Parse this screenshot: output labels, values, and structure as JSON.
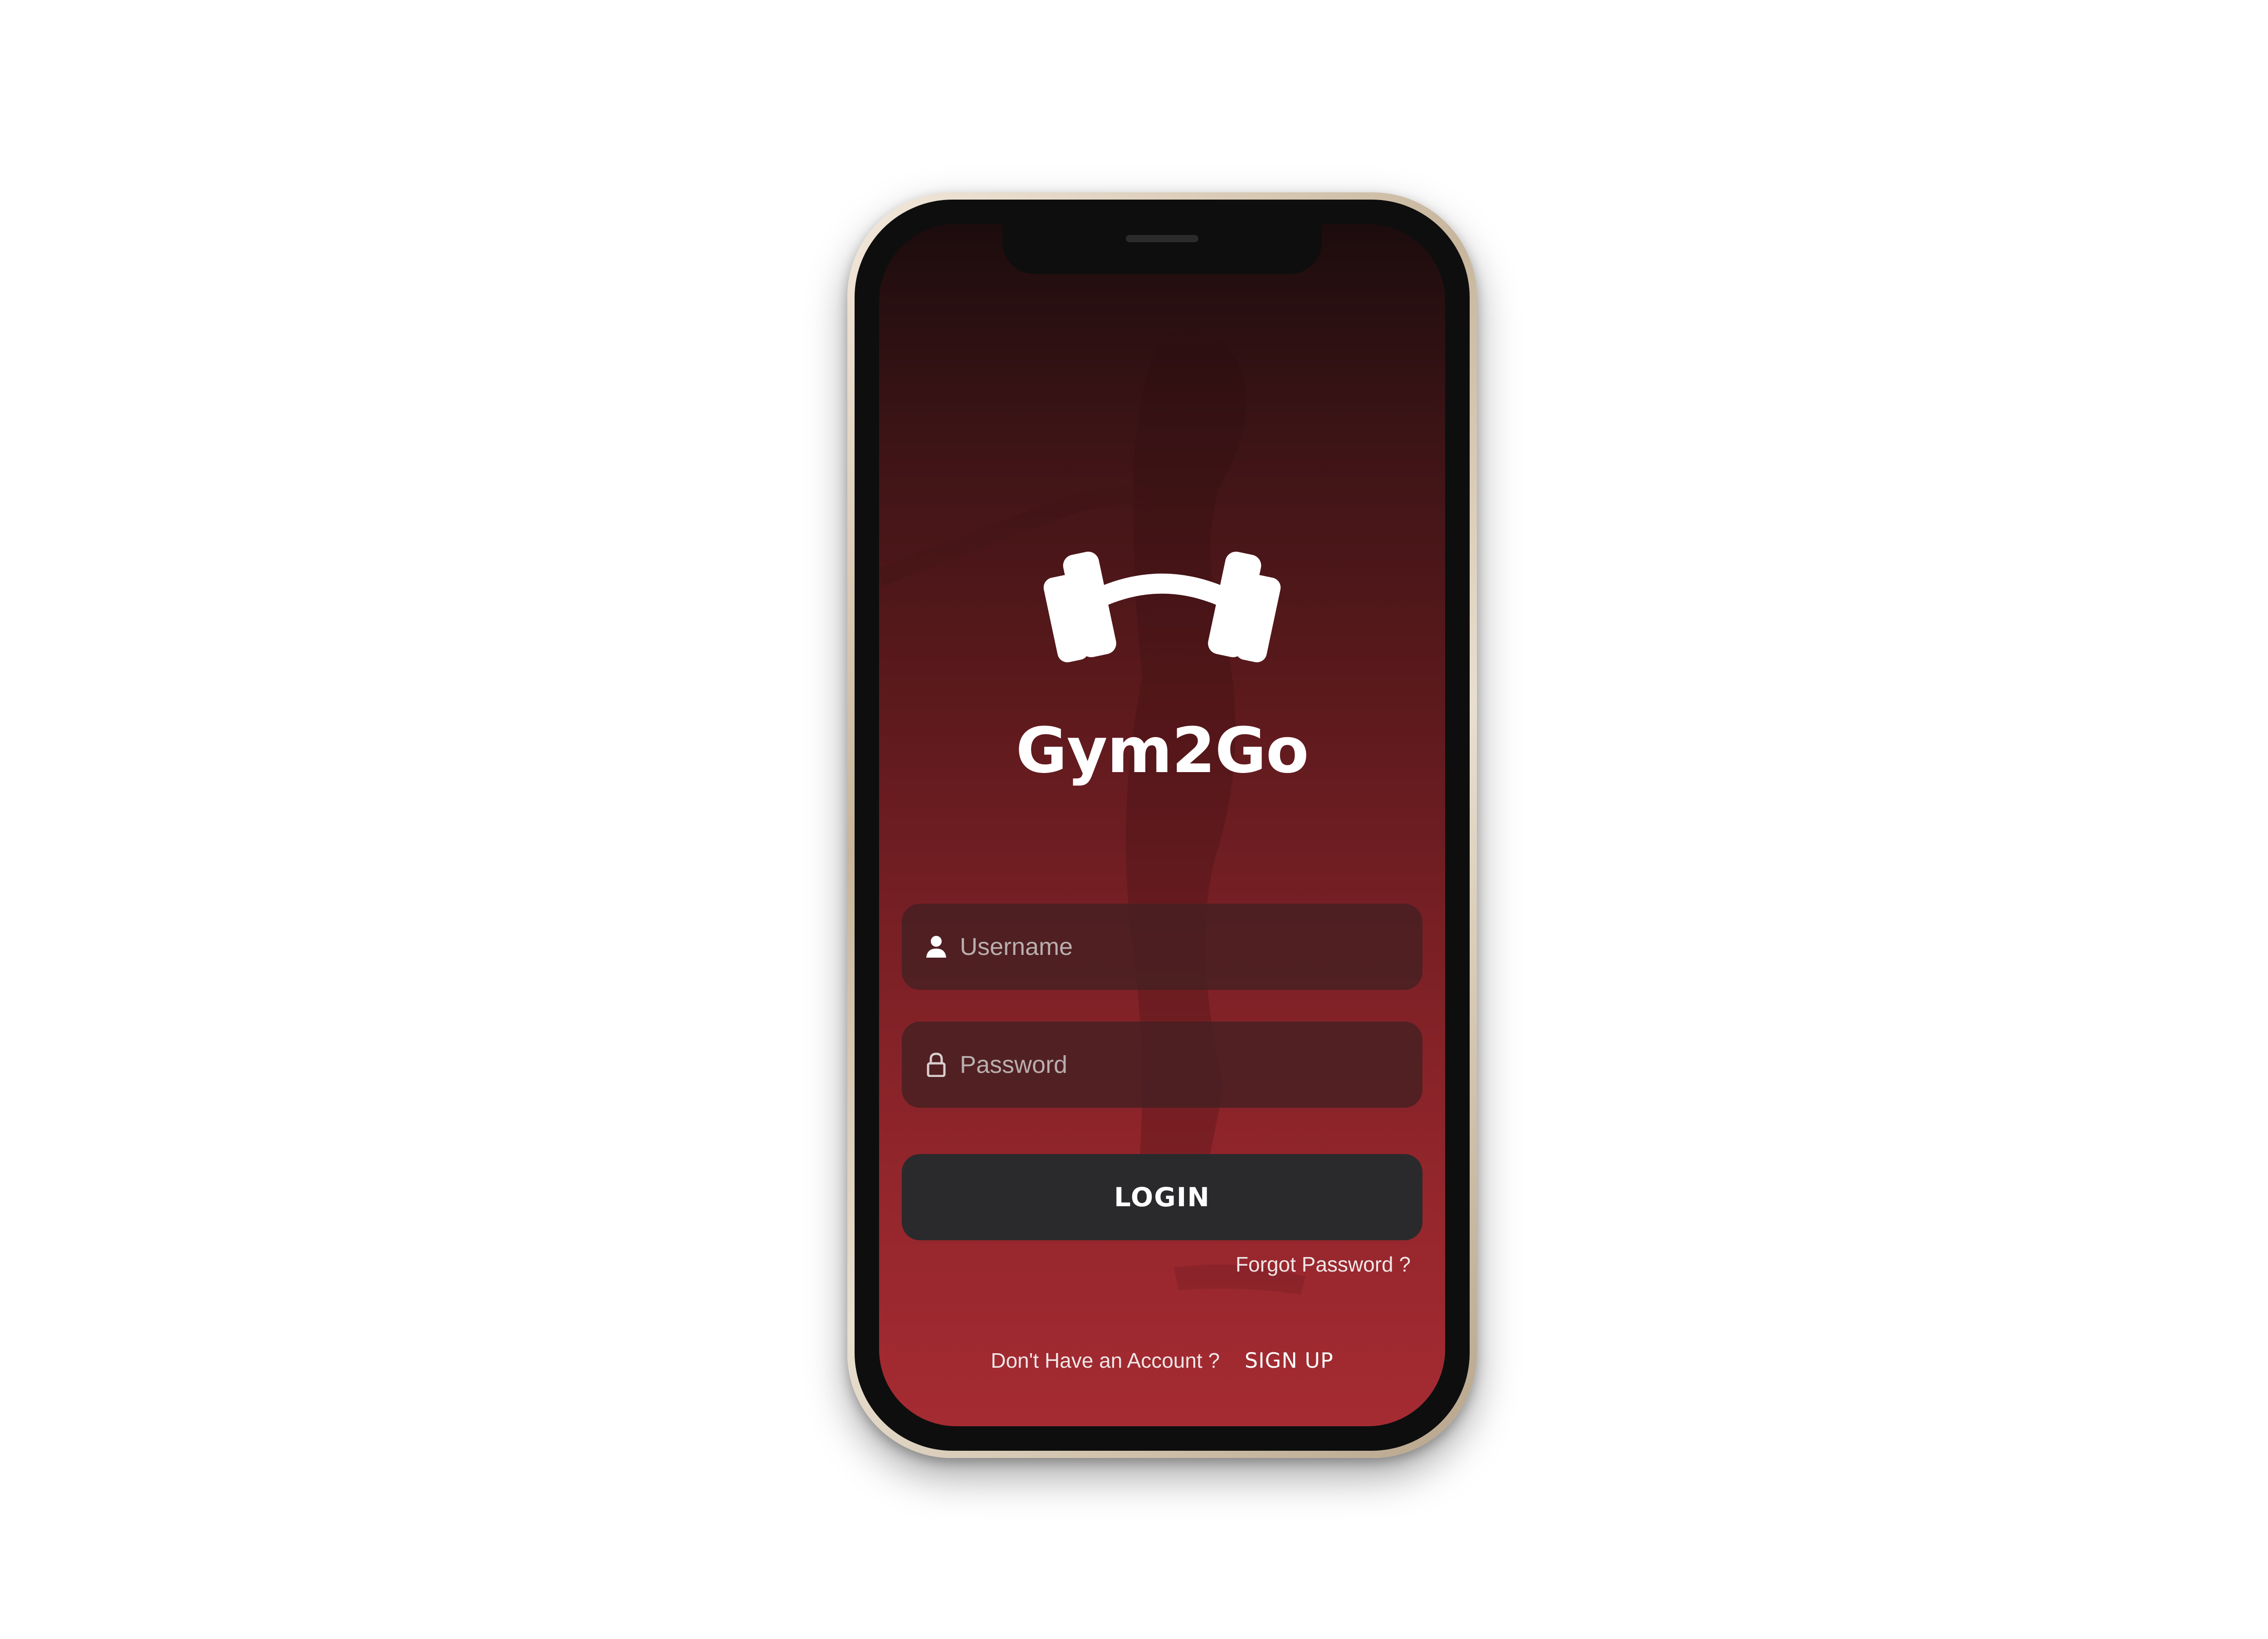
{
  "app": {
    "brand_name": "Gym2Go",
    "logo_icon": "dumbbell-icon"
  },
  "form": {
    "username": {
      "placeholder": "Username",
      "value": "",
      "icon": "user-icon"
    },
    "password": {
      "placeholder": "Password",
      "value": "",
      "icon": "lock-icon"
    },
    "login_label": "LOGIN",
    "forgot_label": "Forgot Password ?"
  },
  "footer": {
    "prompt": "Don't Have an Account ?",
    "signup_label": "SIGN UP"
  },
  "colors": {
    "screen_top": "#1c0c0d",
    "screen_bottom": "#a52b32",
    "field_bg": "#462022",
    "button_bg": "#2a2a2c",
    "text": "#ffffff"
  }
}
